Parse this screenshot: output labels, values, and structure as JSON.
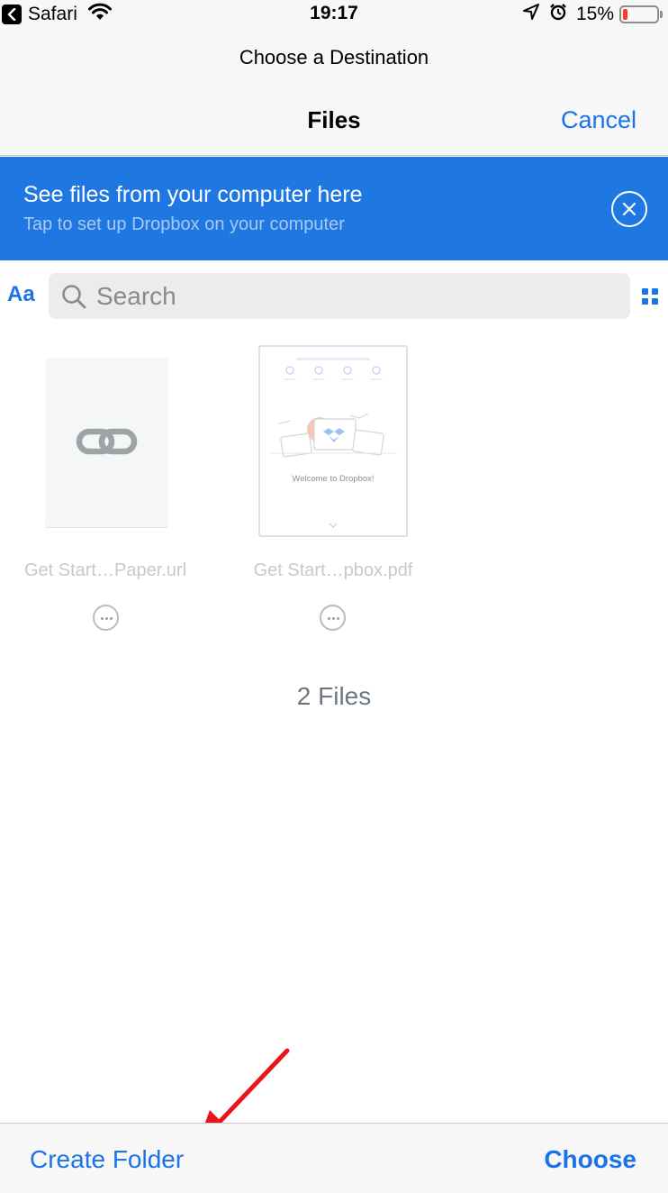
{
  "status_bar": {
    "back_app": "Safari",
    "time": "19:17",
    "battery_percent": "15%",
    "battery_level": 0.15,
    "icons": [
      "back-icon",
      "wifi-icon",
      "location-icon",
      "alarm-icon",
      "battery-icon"
    ]
  },
  "nav": {
    "prompt": "Choose a Destination",
    "title": "Files",
    "cancel_label": "Cancel"
  },
  "banner": {
    "title": "See files from your computer here",
    "subtitle": "Tap to set up Dropbox on your computer",
    "color": "#1f78e2"
  },
  "search": {
    "text_size_label": "Aa",
    "placeholder": "Search"
  },
  "files": [
    {
      "name": "Get Start…Paper.url",
      "thumbnail": "link-icon"
    },
    {
      "name": "Get Start…pbox.pdf",
      "thumbnail": "pdf-preview",
      "preview_heading": "Welcome to Dropbox!"
    }
  ],
  "file_count": "2 Files",
  "toolbar": {
    "create_folder_label": "Create Folder",
    "choose_label": "Choose"
  },
  "colors": {
    "accent": "#1a73e8",
    "annotation_arrow": "#e8151b"
  }
}
